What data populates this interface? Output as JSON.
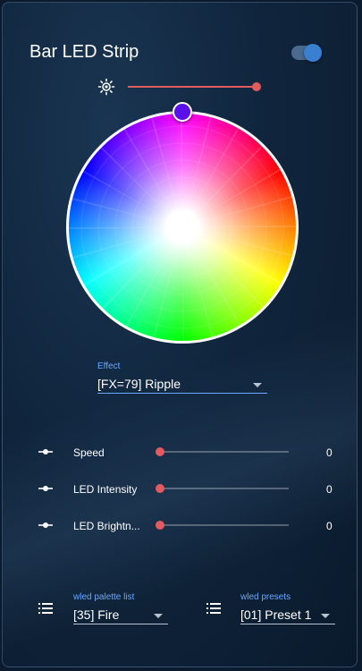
{
  "card": {
    "title": "Bar LED Strip",
    "power_on": true
  },
  "brightness": {
    "value": 100,
    "icon": "brightness-icon"
  },
  "color_wheel": {
    "selected_color": "#5a10e8"
  },
  "effect": {
    "label": "Effect",
    "value": "[FX=79] Ripple"
  },
  "sliders": [
    {
      "label": "Speed",
      "value": "0",
      "icon": "slider-icon"
    },
    {
      "label": "LED Intensity",
      "value": "0",
      "icon": "slider-icon"
    },
    {
      "label": "LED Brightn...",
      "value": "0",
      "icon": "slider-icon"
    }
  ],
  "palette": {
    "label": "wled palette list",
    "value": "[35] Fire",
    "icon": "list-icon"
  },
  "presets": {
    "label": "wled presets",
    "value": "[01] Preset 1",
    "icon": "list-icon"
  },
  "colors": {
    "accent": "#e35b5f",
    "label_blue": "#6aa8ff",
    "toggle_knob": "#3a7fd0"
  }
}
